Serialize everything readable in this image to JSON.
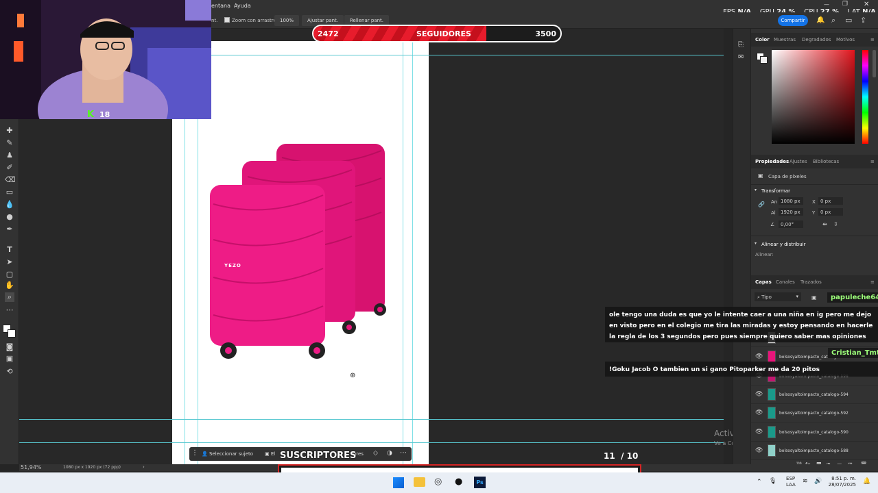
{
  "menubar": {
    "items": [
      "entana",
      "Ayuda"
    ],
    "perf": {
      "fps_label": "FPS",
      "fps_value": "N/A",
      "gpu_label": "GPU",
      "gpu_value": "24 %",
      "cpu_label": "CPU",
      "cpu_value": "27 %",
      "lat_label": "LAT",
      "lat_value": "N/A"
    }
  },
  "options": {
    "prefix": "nt.",
    "zoom_drag_label": "Zoom con arrastre",
    "zoom_100": "100%",
    "fit_label": "Ajustar pant.",
    "fill_label": "Rellenar pant."
  },
  "share_label": "Compartir",
  "followers": {
    "current": "2472",
    "label": "SEGUIDORES",
    "goal": "3500",
    "progress": 0.7
  },
  "webcam": {
    "badge_letter": "K",
    "badge_count": "18"
  },
  "color_panel": {
    "tabs": [
      "Color",
      "Muestras",
      "Degradados",
      "Motivos"
    ]
  },
  "properties_panel": {
    "tabs": [
      "Propiedades",
      "Ajustes",
      "Bibliotecas"
    ],
    "layer_type": "Capa de píxeles",
    "transform_label": "Transformar",
    "w_label": "An",
    "w_value": "1080 px",
    "x_label": "X",
    "x_value": "0 px",
    "h_label": "Al",
    "h_value": "1920 px",
    "y_label": "Y",
    "y_value": "0 px",
    "angle_value": "0,00°",
    "align_label": "Alinear y distribuir",
    "align_sub": "Alinear:"
  },
  "layers_panel": {
    "tabs": [
      "Capas",
      "Canales",
      "Trazados"
    ],
    "filter_label": "Tipo",
    "layers": [
      "bolsosyaltoimpacto_catalogo-600",
      "bolsosyaltoimpacto_catalogo-598",
      "bolsosyaltoimpacto_catalogo-596",
      "bolsosyaltoimpacto_catalogo-594",
      "bolsosyaltoimpacto_catalogo-592",
      "bolsosyaltoimpacto_catalogo-590",
      "bolsosyaltoimpacto_catalogo-588"
    ]
  },
  "chat": [
    {
      "user": "papuleche64",
      "message": "ole tengo una duda es que yo le intente caer a una niña en ig pero me dejo en visto pero en el colegio me tira las miradas y estoy pensando en hacerle la regla de los 3 segundos pero pues siempre quiero saber mas opiniones"
    },
    {
      "user": "Cristian_Tmt",
      "message": "!Goku Jacob O tambien un si gano Pitoparker me da 20 pitos"
    }
  ],
  "canvas": {
    "brand_text": "YEZO"
  },
  "context_bar": {
    "select_subject": "Seleccionar sujeto",
    "remove_bg_partial": "El",
    "colors_partial": "lores"
  },
  "subs": {
    "label": "SUSCRIPTORES",
    "current": "11",
    "goal": "/ 10"
  },
  "watermark": {
    "title": "Activar Windows",
    "subtitle": "Ve a Configuración para activar Windows."
  },
  "status": {
    "zoom": "51,94%",
    "doc_info": "1080 px x 1920 px (72 ppp)"
  },
  "taskbar": {
    "lang1": "ESP",
    "lang2": "LAA",
    "time": "8:51 p. m.",
    "date": "28/07/2025"
  },
  "colors": {
    "accent_blue": "#1473e6",
    "follower_red": "#e81c2c",
    "suitcase_pink": "#e8157a",
    "chat_user_green": "#9dff7a",
    "guide_cyan": "#7fe0e6"
  }
}
